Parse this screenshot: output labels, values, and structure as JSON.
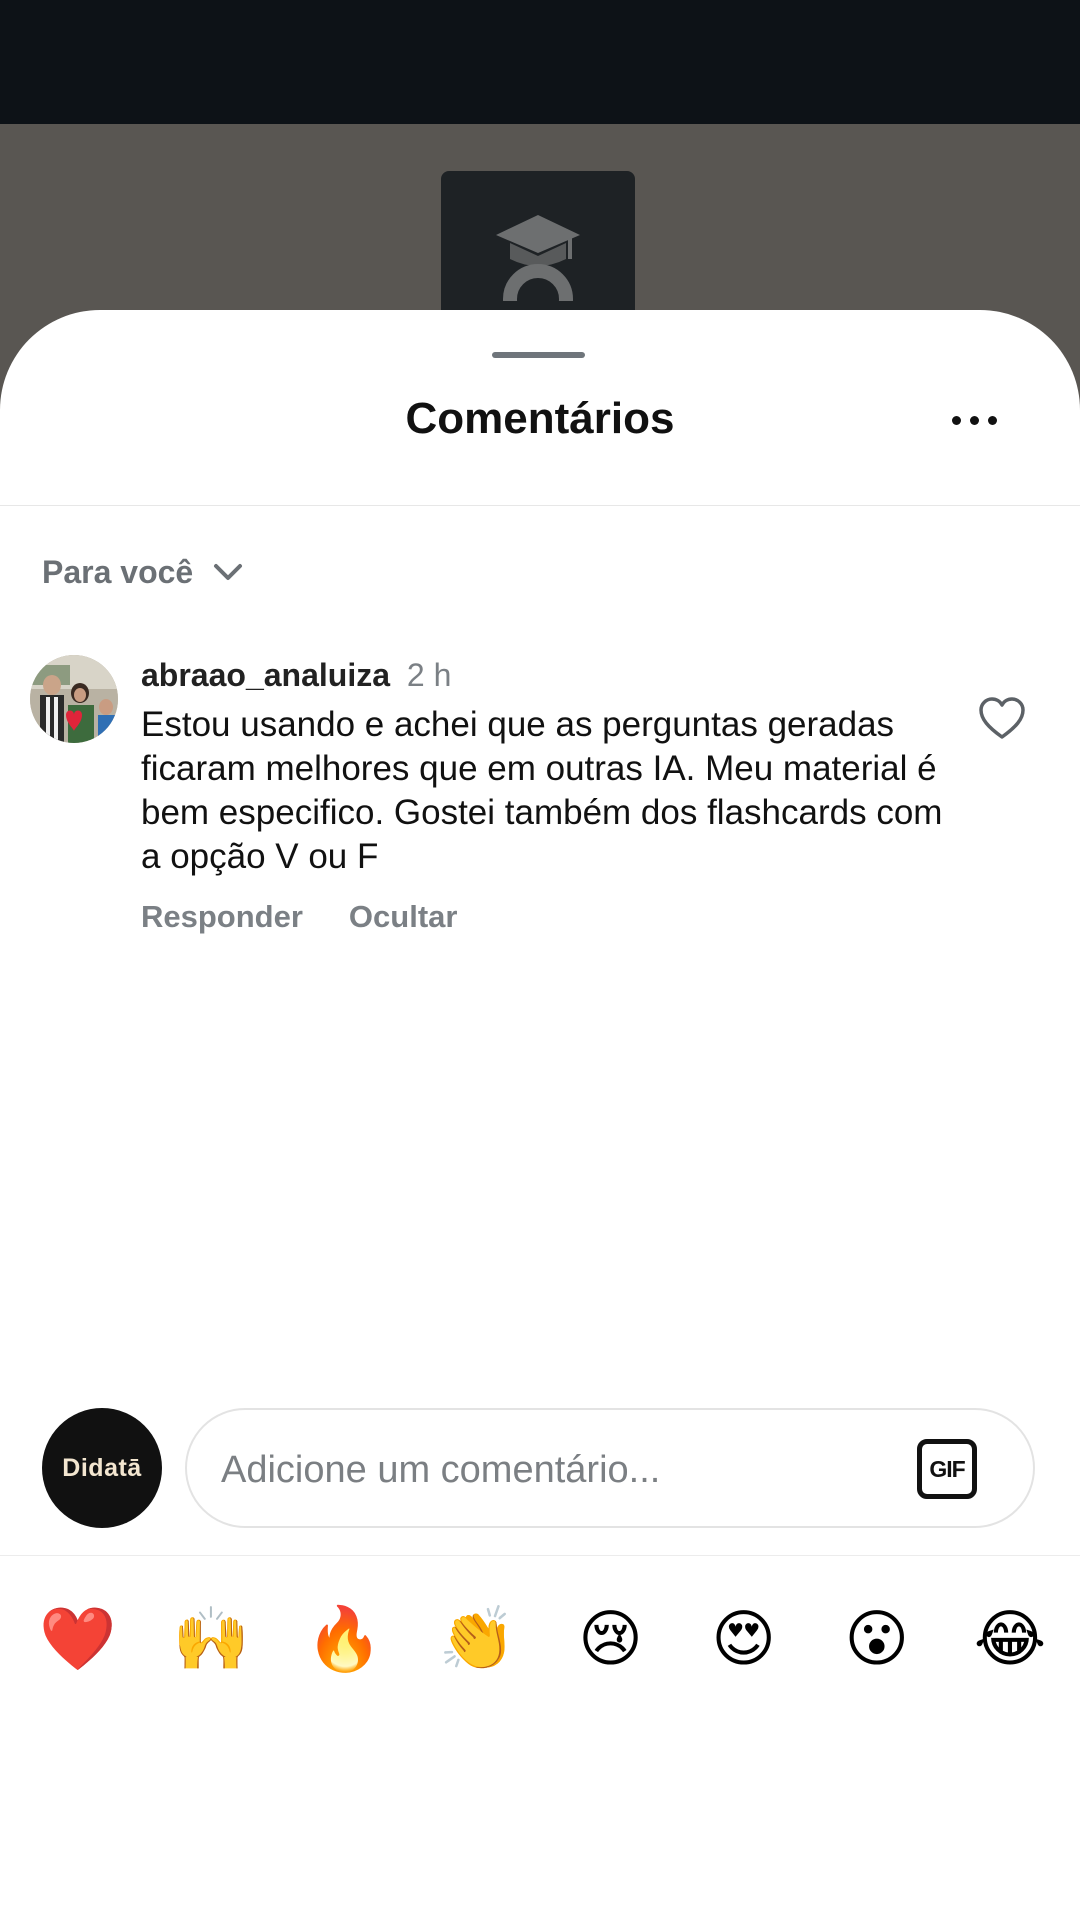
{
  "sheet": {
    "title": "Comentários",
    "more_icon": "more-horizontal-icon"
  },
  "filter": {
    "label": "Para você",
    "icon": "chevron-down-icon"
  },
  "comment": {
    "username": "abraao_analuiza",
    "time": "2 h",
    "text": "Estou usando e achei que as perguntas geradas ficaram melhores que em outras IA. Meu material é bem especifico. Gostei também dos flashcards com a opção V ou F",
    "reply_label": "Responder",
    "hide_label": "Ocultar",
    "like_icon": "heart-outline-icon"
  },
  "emojis": [
    {
      "name": "red-heart",
      "glyph": "❤️"
    },
    {
      "name": "raising-hands",
      "glyph": "🙌"
    },
    {
      "name": "fire",
      "glyph": "🔥"
    },
    {
      "name": "clapping-hands",
      "glyph": "👏"
    },
    {
      "name": "crying-face",
      "glyph": "😢"
    },
    {
      "name": "heart-eyes",
      "glyph": "😍"
    },
    {
      "name": "surprised-face",
      "glyph": "😮"
    },
    {
      "name": "tears-of-joy",
      "glyph": "😂"
    }
  ],
  "composer": {
    "avatar_brand": "Didatā",
    "placeholder": "Adicione um comentário...",
    "value": "",
    "gif_label": "GIF"
  },
  "colors": {
    "accent_text": "#111111",
    "secondary_text": "#7b8085",
    "backdrop": "#595652",
    "status_bar": "#0d1217"
  }
}
